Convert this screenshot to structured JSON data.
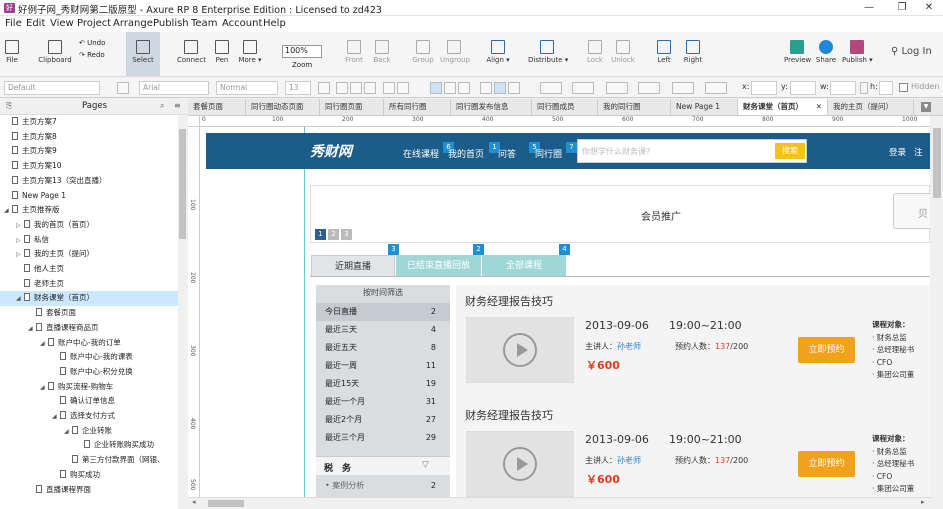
{
  "window": {
    "title": "好例子网_秀财网第二版原型 - Axure RP 8 Enterprise Edition : Licensed to zd423",
    "app_icon": "好",
    "min": "—",
    "restore": "❐",
    "close": "✕"
  },
  "menu": [
    "File",
    "Edit",
    "View",
    "Project",
    "Arrange",
    "Publish",
    "Team",
    "Account",
    "Help"
  ],
  "toolbar": {
    "file": "File",
    "clipboard": "Clipboard",
    "undo": "Undo",
    "redo": "Redo",
    "select": "Select",
    "connect": "Connect",
    "pen": "Pen",
    "more": "More ▾",
    "zoom_value": "100%",
    "zoom": "Zoom",
    "front": "Front",
    "back": "Back",
    "group": "Group",
    "ungroup": "Ungroup",
    "align": "Align ▾",
    "distribute": "Distribute ▾",
    "lock": "Lock",
    "unlock": "Unlock",
    "left": "Left",
    "right": "Right",
    "preview": "Preview",
    "share": "Share",
    "publish": "Publish ▾",
    "login": "Log In"
  },
  "formatbar": {
    "style": "Default",
    "font": "Arial",
    "weight": "Normal",
    "size": "13",
    "x": "x:",
    "y": "y:",
    "w": "w:",
    "h": "h:",
    "hidden": "Hidden"
  },
  "pages": {
    "header": "Pages",
    "items": [
      {
        "label": "主页方案7",
        "indent": 0,
        "tw": ""
      },
      {
        "label": "主页方案8",
        "indent": 0,
        "tw": ""
      },
      {
        "label": "主页方案9",
        "indent": 0,
        "tw": ""
      },
      {
        "label": "主页方案10",
        "indent": 0,
        "tw": ""
      },
      {
        "label": "主页方案13（突出直播）",
        "indent": 0,
        "tw": ""
      },
      {
        "label": "New Page 1",
        "indent": 0,
        "tw": ""
      },
      {
        "label": "主页推荐版",
        "indent": 0,
        "tw": "◢"
      },
      {
        "label": "我的首页（首页）",
        "indent": 1,
        "tw": "▷"
      },
      {
        "label": "私信",
        "indent": 1,
        "tw": "▷"
      },
      {
        "label": "我的主页（提问）",
        "indent": 1,
        "tw": "▷"
      },
      {
        "label": "他人主页",
        "indent": 1,
        "tw": ""
      },
      {
        "label": "老师主页",
        "indent": 1,
        "tw": ""
      },
      {
        "label": "财务课堂（首页）",
        "indent": 1,
        "tw": "◢"
      },
      {
        "label": "套餐页面",
        "indent": 2,
        "tw": ""
      },
      {
        "label": "直播课程商品页",
        "indent": 2,
        "tw": "◢"
      },
      {
        "label": "账户中心-我的订单",
        "indent": 3,
        "tw": "◢"
      },
      {
        "label": "账户中心-我的课表",
        "indent": 4,
        "tw": ""
      },
      {
        "label": "账户中心-积分兑换",
        "indent": 4,
        "tw": ""
      },
      {
        "label": "购买流程-购物车",
        "indent": 3,
        "tw": "◢"
      },
      {
        "label": "确认订单信息",
        "indent": 4,
        "tw": ""
      },
      {
        "label": "选择支付方式",
        "indent": 4,
        "tw": "◢"
      },
      {
        "label": "企业转账",
        "indent": 5,
        "tw": "◢"
      },
      {
        "label": "企业转账购买成功",
        "indent": 6,
        "tw": ""
      },
      {
        "label": "第三方付款界面（网银、",
        "indent": 5,
        "tw": ""
      },
      {
        "label": "购买成功",
        "indent": 4,
        "tw": ""
      },
      {
        "label": "直播课程界面",
        "indent": 2,
        "tw": ""
      }
    ]
  },
  "tabs": [
    "套餐页面",
    "同行圈动态页面",
    "同行圈页面",
    "所有同行圈",
    "同行圈发布信息",
    "同行圈成员",
    "我的同行圈",
    "New Page 1",
    "财务课堂（首页）",
    "我的主页（提问）"
  ],
  "ruler": {
    "h": [
      "0",
      "100",
      "200",
      "300",
      "400",
      "500",
      "600",
      "700",
      "800",
      "900",
      "1000"
    ],
    "v": [
      "100",
      "200",
      "300",
      "400",
      "500"
    ]
  },
  "site": {
    "logo": "秀财网",
    "nav": [
      {
        "label": "在线课程",
        "badge": "6"
      },
      {
        "label": "我的首页",
        "badge": "1"
      },
      {
        "label": "问答",
        "badge": "5"
      },
      {
        "label": "同行圈",
        "badge": "7"
      }
    ],
    "search_placeholder": "你想学什么财务课?",
    "search_btn": "搜索",
    "login": "登录",
    "login2": "注",
    "promo_title": "会员推广",
    "promo_side": "贝",
    "dots": [
      "1",
      "2",
      "3"
    ],
    "course_tabs": [
      {
        "label": "近期直播",
        "badge": ""
      },
      {
        "label": "已结束直播回放",
        "badge": "3"
      },
      {
        "label": "全部课程",
        "badge": "2"
      }
    ],
    "tab_badge_end": "4",
    "filter_title": "按时间筛选",
    "filters": [
      {
        "label": "今日直播",
        "count": "2"
      },
      {
        "label": "最近三天",
        "count": "4"
      },
      {
        "label": "最近五天",
        "count": "8"
      },
      {
        "label": "最近一周",
        "count": "11"
      },
      {
        "label": "最近15天",
        "count": "19"
      },
      {
        "label": "最近一个月",
        "count": "31"
      },
      {
        "label": "最近2个月",
        "count": "27"
      },
      {
        "label": "最近三个月",
        "count": "29"
      }
    ],
    "tax_title": "税　务",
    "tax_arrow": "▽",
    "tax_item": {
      "label": "• 案例分析",
      "count": "2"
    },
    "courses": [
      {
        "title": "财务经理报告技巧",
        "date": "2013-09-06",
        "time": "19:00~21:00",
        "lecturer_label": "主讲人：",
        "lecturer": "孙老师",
        "reserve_label": "预约人数：",
        "reserve_cur": "137",
        "reserve_max": "/200",
        "price": "￥600",
        "button": "立即预约",
        "target_title": "课程对象：",
        "targets": [
          "· 财务总监",
          "· 总经理秘书",
          "· CFO",
          "· 集团公司董"
        ]
      },
      {
        "title": "财务经理报告技巧",
        "date": "2013-09-06",
        "time": "19:00~21:00",
        "lecturer_label": "主讲人：",
        "lecturer": "孙老师",
        "reserve_label": "预约人数：",
        "reserve_cur": "137",
        "reserve_max": "/200",
        "price": "￥600",
        "button": "立即预约",
        "target_title": "课程对象：",
        "targets": [
          "· 财务总监",
          "· 总经理秘书",
          "· CFO",
          "· 集团公司董"
        ]
      }
    ]
  }
}
